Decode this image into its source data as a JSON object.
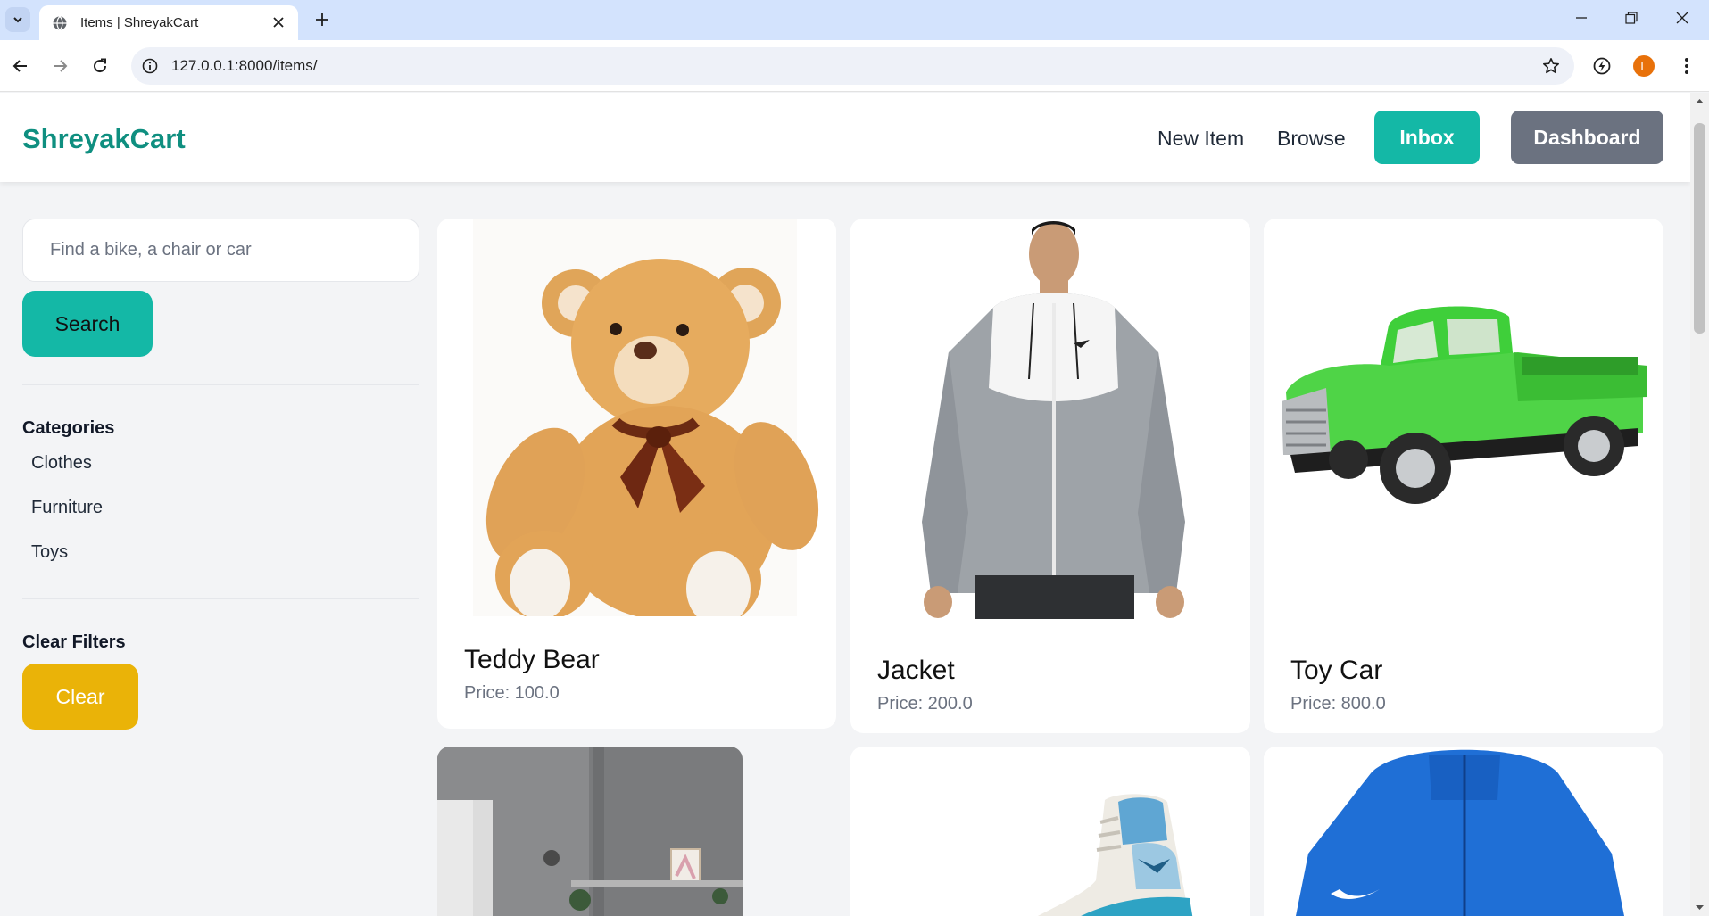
{
  "browser": {
    "tab_title": "Items | ShreyakCart",
    "url": "127.0.0.1:8000/items/",
    "profile_initial": "L"
  },
  "nav": {
    "logo": "ShreyakCart",
    "new_item": "New Item",
    "browse": "Browse",
    "inbox": "Inbox",
    "dashboard": "Dashboard"
  },
  "sidebar": {
    "search_placeholder": "Find a bike, a chair or car",
    "search_button": "Search",
    "categories_title": "Categories",
    "categories": [
      "Clothes",
      "Furniture",
      "Toys"
    ],
    "clear_title": "Clear Filters",
    "clear_button": "Clear"
  },
  "items": [
    {
      "name": "Teddy Bear",
      "price": "Price: 100.0"
    },
    {
      "name": "Jacket",
      "price": "Price: 200.0"
    },
    {
      "name": "Toy Car",
      "price": "Price: 800.0"
    }
  ],
  "colors": {
    "brand": "#0f8f80",
    "teal_button": "#14b8a6",
    "gray_button": "#6b7280",
    "clear_button": "#eab308"
  },
  "icons": [
    "tab-list-icon",
    "globe-icon",
    "close-icon",
    "plus-icon",
    "minimize-icon",
    "restore-icon",
    "window-close-icon",
    "back-icon",
    "forward-icon",
    "reload-icon",
    "site-info-icon",
    "bookmark-star-icon",
    "extensions-icon",
    "menu-icon"
  ]
}
